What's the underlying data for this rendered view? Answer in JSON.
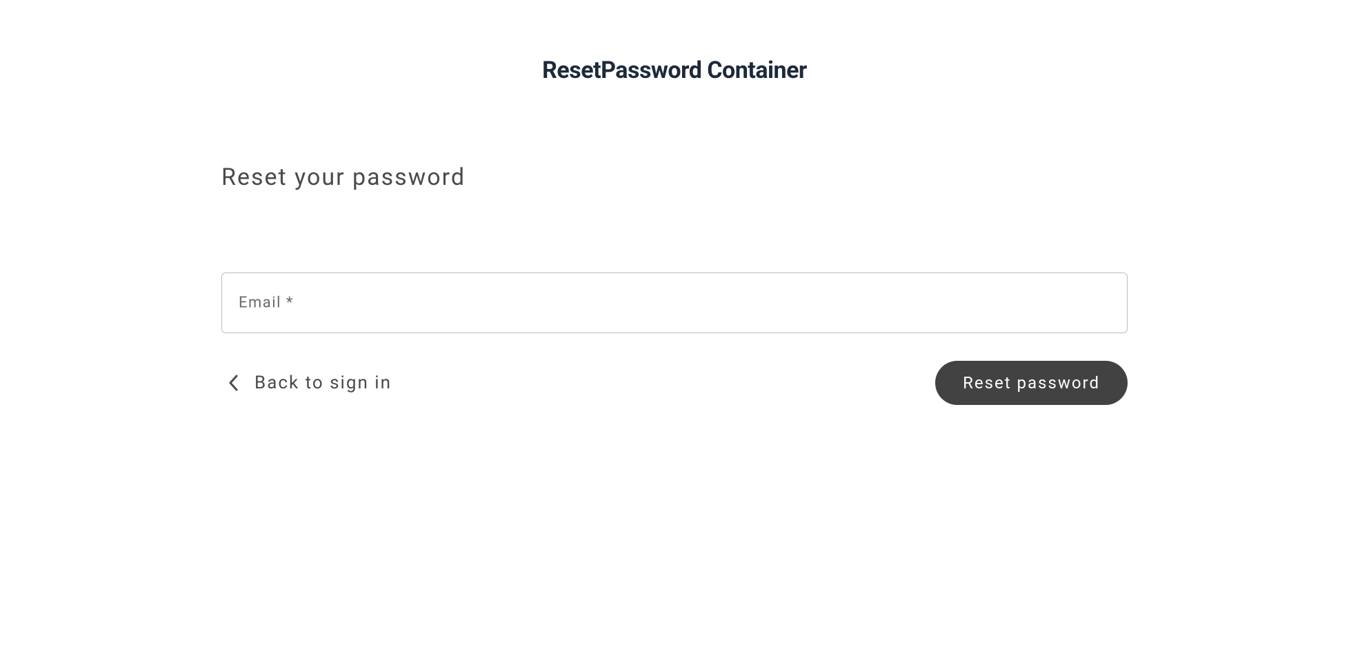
{
  "page": {
    "title": "ResetPassword Container"
  },
  "form": {
    "heading": "Reset your password",
    "email": {
      "label": "Email *",
      "value": ""
    },
    "back_link": "Back to sign in",
    "submit_label": "Reset password"
  }
}
